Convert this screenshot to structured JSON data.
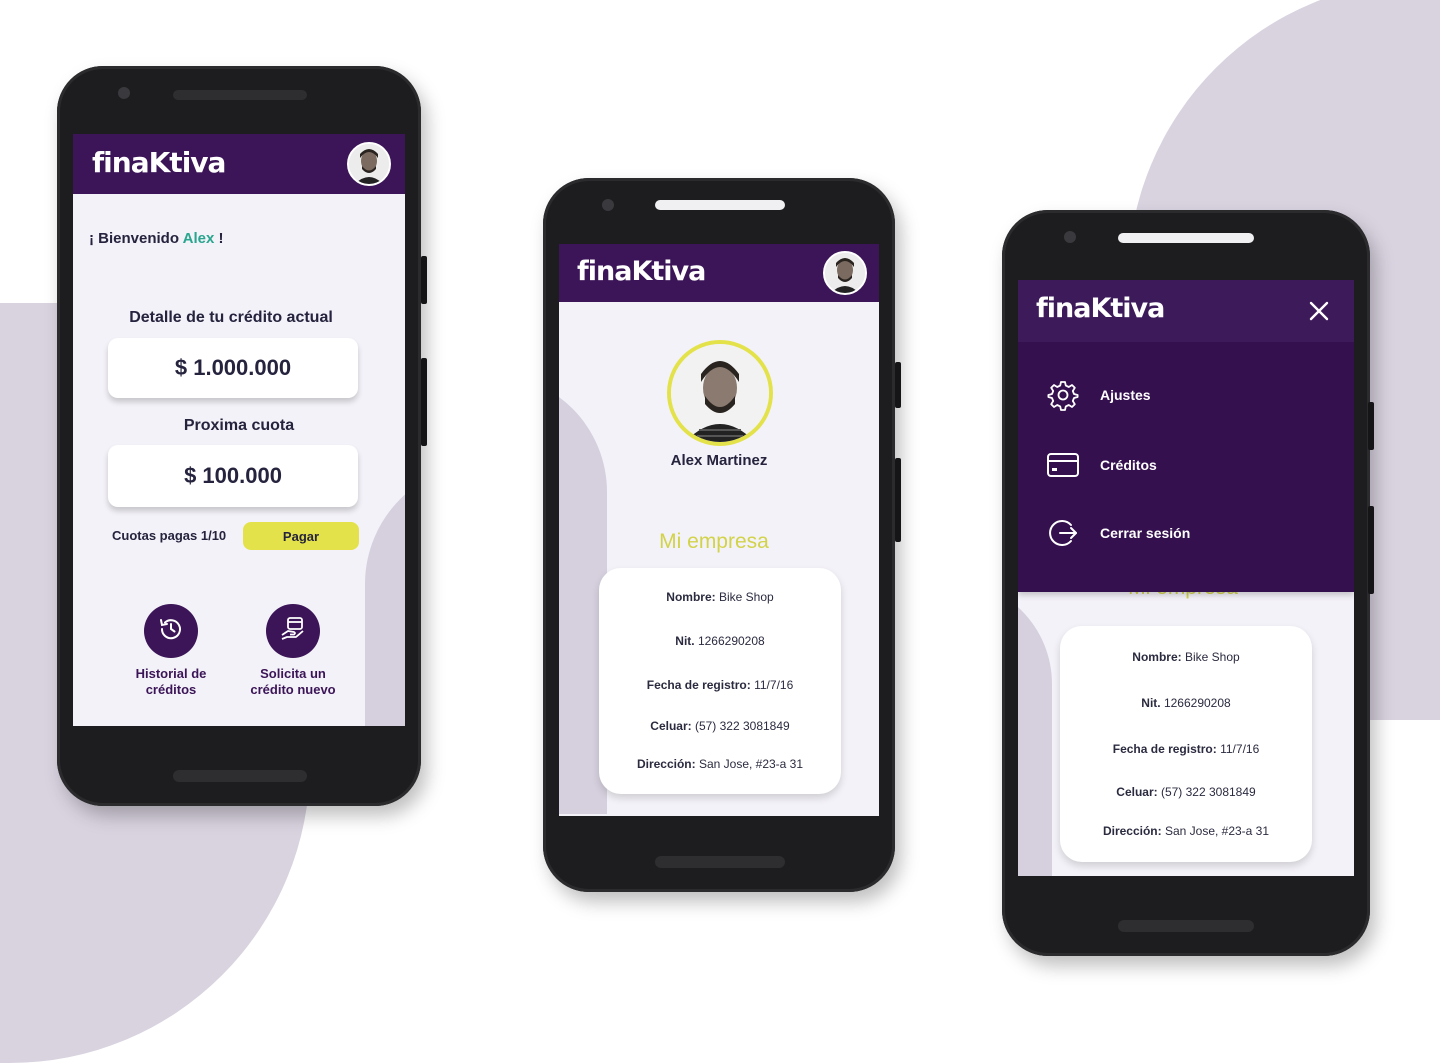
{
  "brand": {
    "logo_text": "finaKtiva",
    "primary_color": "#3b1557",
    "accent_color": "#e4e24a",
    "highlight_name_color": "#2aa58f"
  },
  "screen1": {
    "welcome_prefix": "¡ Bienvenido ",
    "welcome_name": "Alex",
    "welcome_suffix": " !",
    "credit_label": "Detalle de tu crédito actual",
    "credit_amount": "$ 1.000.000",
    "next_label": "Proxima cuota",
    "next_amount": "$ 100.000",
    "installments": "Cuotas pagas 1/10",
    "pay_button": "Pagar",
    "actions": [
      {
        "label_line1": "Historial de",
        "label_line2": "créditos",
        "icon": "history-icon"
      },
      {
        "label_line1": "Solicita un",
        "label_line2": "crédito nuevo",
        "icon": "card-hand-icon"
      }
    ]
  },
  "screen2": {
    "user_name": "Alex Martinez",
    "section_title": "Mi empresa",
    "company": [
      {
        "label": "Nombre:",
        "value": " Bike Shop"
      },
      {
        "label": "Nit.",
        "value": "  1266290208"
      },
      {
        "label": "Fecha de registro:",
        "value": " 11/7/16"
      },
      {
        "label": "Celuar:",
        "value": " (57) 322 3081849"
      },
      {
        "label": "Dirección:",
        "value": " San Jose,  #23-a 31"
      }
    ]
  },
  "screen3": {
    "close_icon": "close-icon",
    "menu": [
      {
        "label": "Ajustes",
        "icon": "gear-icon"
      },
      {
        "label": "Créditos",
        "icon": "credit-card-icon"
      },
      {
        "label": "Cerrar sesión",
        "icon": "logout-icon"
      }
    ],
    "section_title_partial": "Mi empresa",
    "company": [
      {
        "label": "Nombre:",
        "value": " Bike Shop"
      },
      {
        "label": "Nit.",
        "value": "  1266290208"
      },
      {
        "label": "Fecha de registro:",
        "value": " 11/7/16"
      },
      {
        "label": "Celuar:",
        "value": " (57) 322 3081849"
      },
      {
        "label": "Dirección:",
        "value": " San Jose,  #23-a 31"
      }
    ]
  }
}
